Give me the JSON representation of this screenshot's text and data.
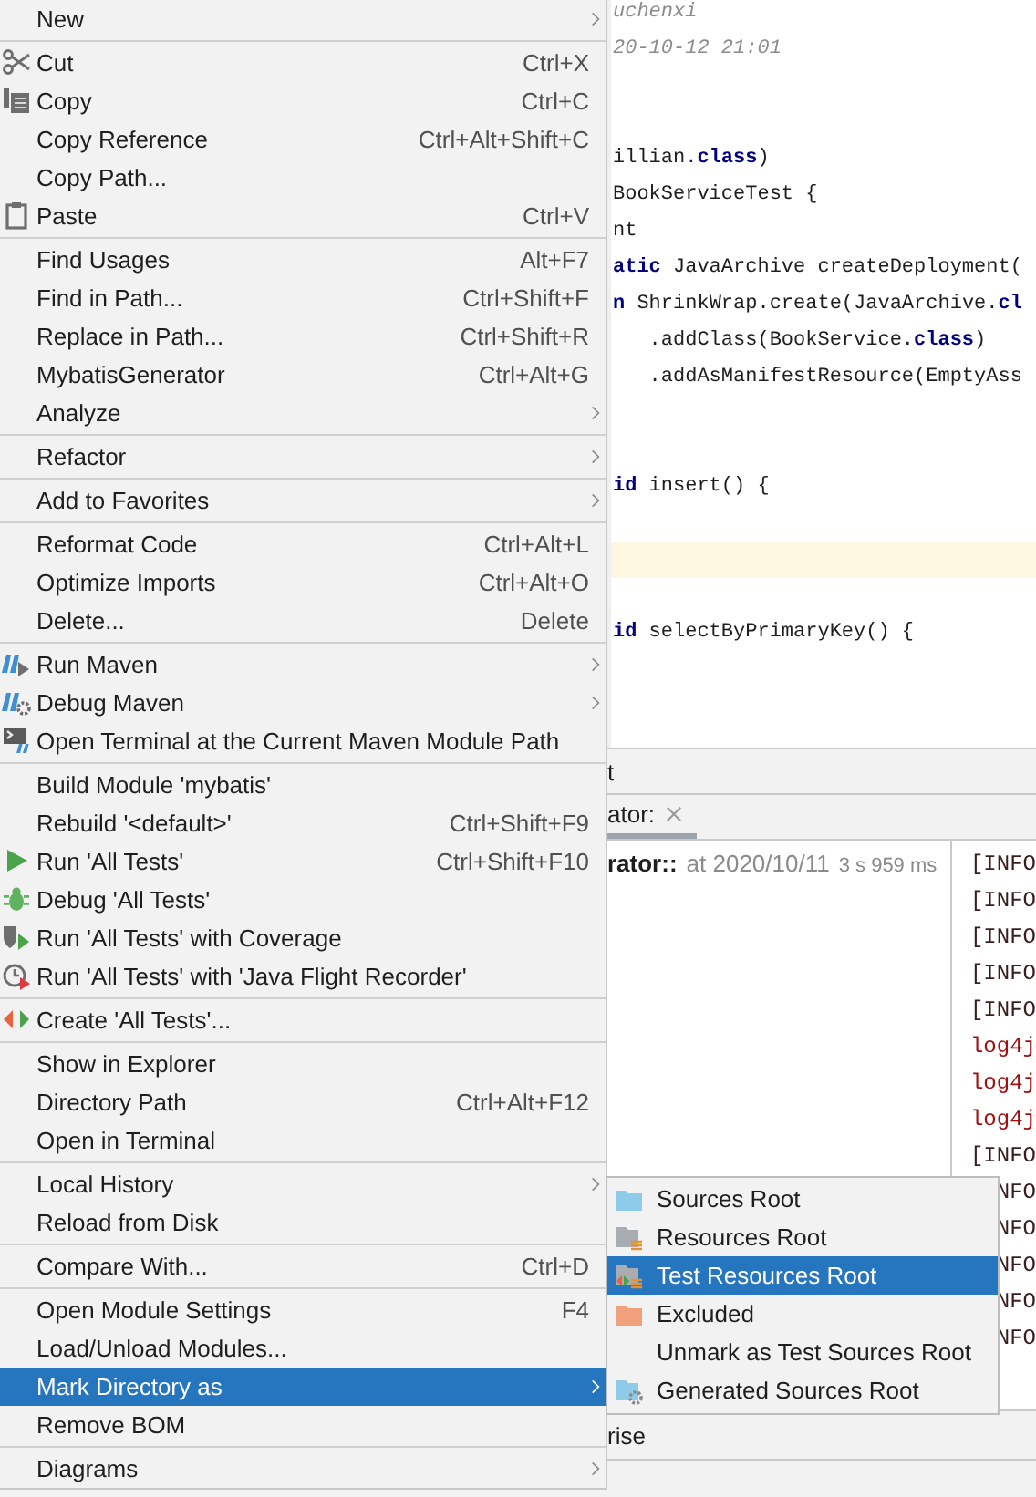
{
  "editor": {
    "lines": [
      {
        "kind": "comment",
        "text": "uchenxi",
        "current": false
      },
      {
        "kind": "comment",
        "text": "20-10-12 21:01",
        "current": false
      },
      {
        "kind": "blank",
        "current": false
      },
      {
        "kind": "blank",
        "current": false
      },
      {
        "kind": "code",
        "text": "illian.**class**)",
        "current": false
      },
      {
        "kind": "code",
        "text": "BookServiceTest {",
        "current": false
      },
      {
        "kind": "code",
        "text": "nt",
        "current": false
      },
      {
        "kind": "code",
        "text": "**atic** JavaArchive createDeployment(",
        "current": false
      },
      {
        "kind": "code",
        "text": "**n** ShrinkWrap.create(JavaArchive.**cl**",
        "current": false
      },
      {
        "kind": "code",
        "text": "   .addClass(BookService.**class**)",
        "current": false
      },
      {
        "kind": "code",
        "text": "   .addAsManifestResource(EmptyAss",
        "current": false
      },
      {
        "kind": "blank",
        "current": false
      },
      {
        "kind": "blank",
        "current": false
      },
      {
        "kind": "code",
        "text": "**id** insert() {",
        "current": false
      },
      {
        "kind": "blank",
        "current": false
      },
      {
        "kind": "blank",
        "current": true
      },
      {
        "kind": "blank",
        "current": false
      },
      {
        "kind": "code",
        "text": "**id** selectByPrimaryKey() {",
        "current": false
      },
      {
        "kind": "blank",
        "current": false
      },
      {
        "kind": "blank",
        "current": false
      }
    ]
  },
  "run_panel": {
    "title": "t",
    "tab": {
      "label": "ator:",
      "selected": true
    },
    "result": {
      "name": "rator::",
      "time": "at 2020/10/11",
      "duration": "3 s 959 ms"
    },
    "console": [
      {
        "kind": "info",
        "text": "[INFO"
      },
      {
        "kind": "info",
        "text": "[INFO"
      },
      {
        "kind": "info",
        "text": "[INFO"
      },
      {
        "kind": "info",
        "text": "[INFO"
      },
      {
        "kind": "info",
        "text": "[INFO"
      },
      {
        "kind": "log",
        "text": "log4j"
      },
      {
        "kind": "log",
        "text": "log4j"
      },
      {
        "kind": "log",
        "text": "log4j"
      },
      {
        "kind": "info",
        "text": "[INFO"
      },
      {
        "kind": "info",
        "text": "NFO"
      },
      {
        "kind": "info",
        "text": "NFO"
      },
      {
        "kind": "info",
        "text": "NFO"
      },
      {
        "kind": "info",
        "text": "NFO"
      },
      {
        "kind": "info",
        "text": "NFO"
      }
    ]
  },
  "status_bar": {
    "text": "rise"
  },
  "context_menu": {
    "items": [
      {
        "kind": "item",
        "label": "New",
        "submenu": true,
        "selected": false
      },
      {
        "kind": "separator"
      },
      {
        "kind": "item",
        "label": "Cut",
        "shortcut": "Ctrl+X",
        "submenu": false,
        "selected": false
      },
      {
        "kind": "item",
        "label": "Copy",
        "shortcut": "Ctrl+C",
        "submenu": false,
        "selected": false
      },
      {
        "kind": "item",
        "label": "Copy Reference",
        "shortcut": "Ctrl+Alt+Shift+C",
        "submenu": false,
        "selected": false
      },
      {
        "kind": "item",
        "label": "Copy Path...",
        "submenu": false,
        "selected": false
      },
      {
        "kind": "item",
        "label": "Paste",
        "shortcut": "Ctrl+V",
        "submenu": false,
        "selected": false
      },
      {
        "kind": "separator"
      },
      {
        "kind": "item",
        "label": "Find Usages",
        "shortcut": "Alt+F7",
        "submenu": false,
        "selected": false
      },
      {
        "kind": "item",
        "label": "Find in Path...",
        "shortcut": "Ctrl+Shift+F",
        "submenu": false,
        "selected": false
      },
      {
        "kind": "item",
        "label": "Replace in Path...",
        "shortcut": "Ctrl+Shift+R",
        "submenu": false,
        "selected": false
      },
      {
        "kind": "item",
        "label": "MybatisGenerator",
        "shortcut": "Ctrl+Alt+G",
        "submenu": false,
        "selected": false
      },
      {
        "kind": "item",
        "label": "Analyze",
        "submenu": true,
        "selected": false
      },
      {
        "kind": "separator"
      },
      {
        "kind": "item",
        "label": "Refactor",
        "submenu": true,
        "selected": false
      },
      {
        "kind": "separator"
      },
      {
        "kind": "item",
        "label": "Add to Favorites",
        "submenu": true,
        "selected": false
      },
      {
        "kind": "separator"
      },
      {
        "kind": "item",
        "label": "Reformat Code",
        "shortcut": "Ctrl+Alt+L",
        "submenu": false,
        "selected": false
      },
      {
        "kind": "item",
        "label": "Optimize Imports",
        "shortcut": "Ctrl+Alt+O",
        "submenu": false,
        "selected": false
      },
      {
        "kind": "item",
        "label": "Delete...",
        "shortcut": "Delete",
        "submenu": false,
        "selected": false
      },
      {
        "kind": "separator"
      },
      {
        "kind": "item",
        "label": "Run Maven",
        "submenu": true,
        "selected": false
      },
      {
        "kind": "item",
        "label": "Debug Maven",
        "submenu": true,
        "selected": false
      },
      {
        "kind": "item",
        "label": "Open Terminal at the Current Maven Module Path",
        "submenu": false,
        "selected": false
      },
      {
        "kind": "separator"
      },
      {
        "kind": "item",
        "label": "Build Module 'mybatis'",
        "submenu": false,
        "selected": false
      },
      {
        "kind": "item",
        "label": "Rebuild '<default>'",
        "shortcut": "Ctrl+Shift+F9",
        "submenu": false,
        "selected": false
      },
      {
        "kind": "item",
        "label": "Run 'All Tests'",
        "shortcut": "Ctrl+Shift+F10",
        "submenu": false,
        "selected": false
      },
      {
        "kind": "item",
        "label": "Debug 'All Tests'",
        "submenu": false,
        "selected": false
      },
      {
        "kind": "item",
        "label": "Run 'All Tests' with Coverage",
        "submenu": false,
        "selected": false
      },
      {
        "kind": "item",
        "label": "Run 'All Tests' with 'Java Flight Recorder'",
        "submenu": false,
        "selected": false
      },
      {
        "kind": "separator"
      },
      {
        "kind": "item",
        "label": "Create 'All Tests'...",
        "submenu": false,
        "selected": false
      },
      {
        "kind": "separator"
      },
      {
        "kind": "item",
        "label": "Show in Explorer",
        "submenu": false,
        "selected": false
      },
      {
        "kind": "item",
        "label": "Directory Path",
        "shortcut": "Ctrl+Alt+F12",
        "submenu": false,
        "selected": false
      },
      {
        "kind": "item",
        "label": "Open in Terminal",
        "submenu": false,
        "selected": false
      },
      {
        "kind": "separator"
      },
      {
        "kind": "item",
        "label": "Local History",
        "submenu": true,
        "selected": false
      },
      {
        "kind": "item",
        "label": "Reload from Disk",
        "submenu": false,
        "selected": false
      },
      {
        "kind": "separator"
      },
      {
        "kind": "item",
        "label": "Compare With...",
        "shortcut": "Ctrl+D",
        "submenu": false,
        "selected": false
      },
      {
        "kind": "separator"
      },
      {
        "kind": "item",
        "label": "Open Module Settings",
        "shortcut": "F4",
        "submenu": false,
        "selected": false
      },
      {
        "kind": "item",
        "label": "Load/Unload Modules...",
        "submenu": false,
        "selected": false
      },
      {
        "kind": "item",
        "label": "Mark Directory as",
        "submenu": true,
        "selected": true
      },
      {
        "kind": "item",
        "label": "Remove BOM",
        "submenu": false,
        "selected": false
      },
      {
        "kind": "separator"
      },
      {
        "kind": "item",
        "label": "Diagrams",
        "submenu": true,
        "selected": false
      }
    ]
  },
  "submenu": {
    "items": [
      {
        "label": "Sources Root",
        "selected": false
      },
      {
        "label": "Resources Root",
        "selected": false
      },
      {
        "label": "Test Resources Root",
        "selected": true
      },
      {
        "label": "Excluded",
        "selected": false
      },
      {
        "label": "Unmark as Test Sources Root",
        "selected": false
      },
      {
        "label": "Generated Sources Root",
        "selected": false
      }
    ]
  }
}
